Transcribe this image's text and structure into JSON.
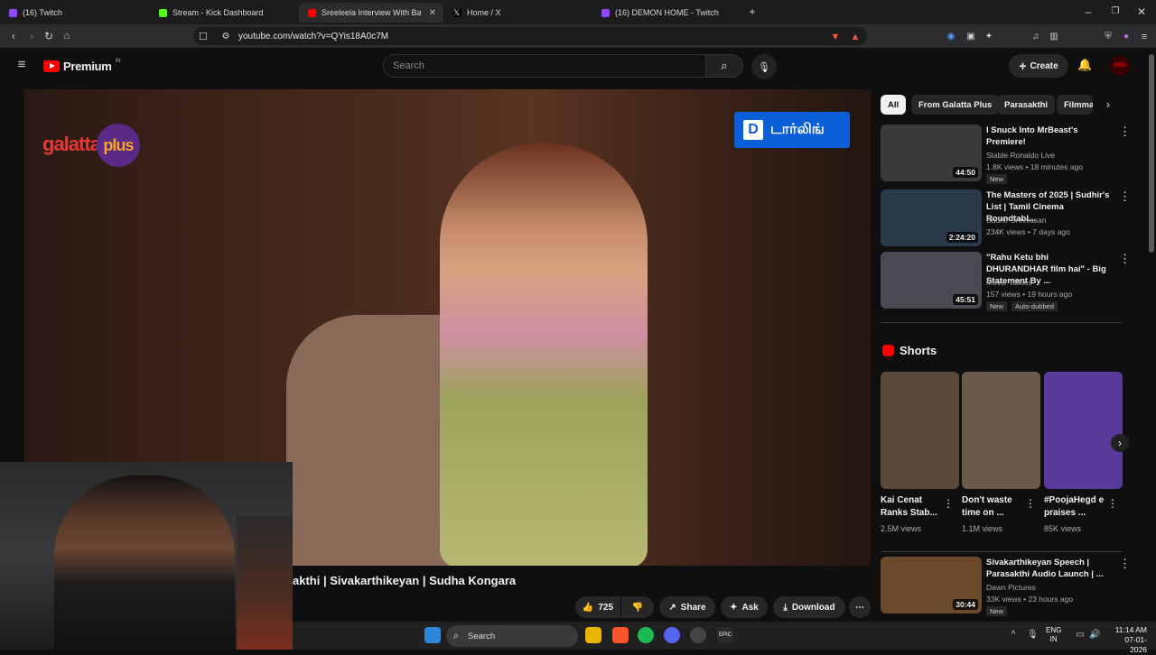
{
  "browser": {
    "tabs": [
      {
        "label": "(16) Twitch",
        "color": "#9146ff"
      },
      {
        "label": "Stream - Kick Dashboard",
        "color": "#53fc18"
      },
      {
        "label": "Sreeleela Interview With Bara...",
        "color": "#ff0000"
      },
      {
        "label": "Home / X",
        "color": "#ffffff"
      },
      {
        "label": "(16) DEMON HOME - Twitch",
        "color": "#9146ff"
      }
    ],
    "url": "youtube.com/watch?v=QYis18A0c7M"
  },
  "header": {
    "logo": "Premium",
    "region": "IN",
    "search_placeholder": "Search",
    "create_label": "Create",
    "avatar_text": "RED"
  },
  "video": {
    "channel_logo": "galatta",
    "channel_logo_plus": "plus",
    "overlay_brand": "டார்லிங்",
    "overlay_d": "D",
    "title": "akthi | Sivakarthikeyan | Sudha Kongara",
    "likes": "725",
    "share": "Share",
    "ask": "Ask",
    "download": "Download"
  },
  "chips": [
    "All",
    "From Galatta Plus",
    "Parasakthi",
    "Filmma"
  ],
  "related": [
    {
      "title": "I Snuck Into MrBeast's Premiere!",
      "channel": "Stable Ronaldo Live",
      "meta": "1.8K views • 18 minutes ago",
      "duration": "44:50",
      "badge": "New",
      "thumb_color": "#3a3a3a"
    },
    {
      "title": "The Masters of 2025 | Sudhir's List | Tamil Cinema Roundtabl...",
      "channel": "Sudhir Srinivasan",
      "meta": "234K views • 7 days ago",
      "duration": "2:24:20",
      "thumb_color": "#2b3a4a"
    },
    {
      "title": "\"Rahu Ketu bhi DHURANDHAR film hai\" - Big Statement By ...",
      "channel": "Movie Talkies",
      "meta": "157 views • 19 hours ago",
      "duration": "45:51",
      "badge": "New",
      "badge2": "Auto-dubbed",
      "thumb_color": "#4a4a52"
    }
  ],
  "shorts": {
    "heading": "Shorts",
    "items": [
      {
        "title": "Kai Cenat Ranks Stab...",
        "views": "2.5M views",
        "color": "#5a4a3a"
      },
      {
        "title": "Don't waste time on ...",
        "views": "1.1M views",
        "color": "#6a5848"
      },
      {
        "title": "#PoojaHegd e praises ...",
        "views": "85K views",
        "color": "#5a3a9a"
      }
    ]
  },
  "related_bottom": {
    "title": "Sivakarthikeyan Speech | Parasakthi Audio Launch | ...",
    "channel": "Dawn Pictures",
    "meta": "33K views • 23 hours ago",
    "duration": "30:44",
    "badge": "New",
    "thumb_color": "#6a4a2a"
  },
  "taskbar": {
    "search": "Search",
    "lang": "ENG",
    "lang2": "IN",
    "time": "11:14 AM",
    "date": "07-01-2026"
  }
}
